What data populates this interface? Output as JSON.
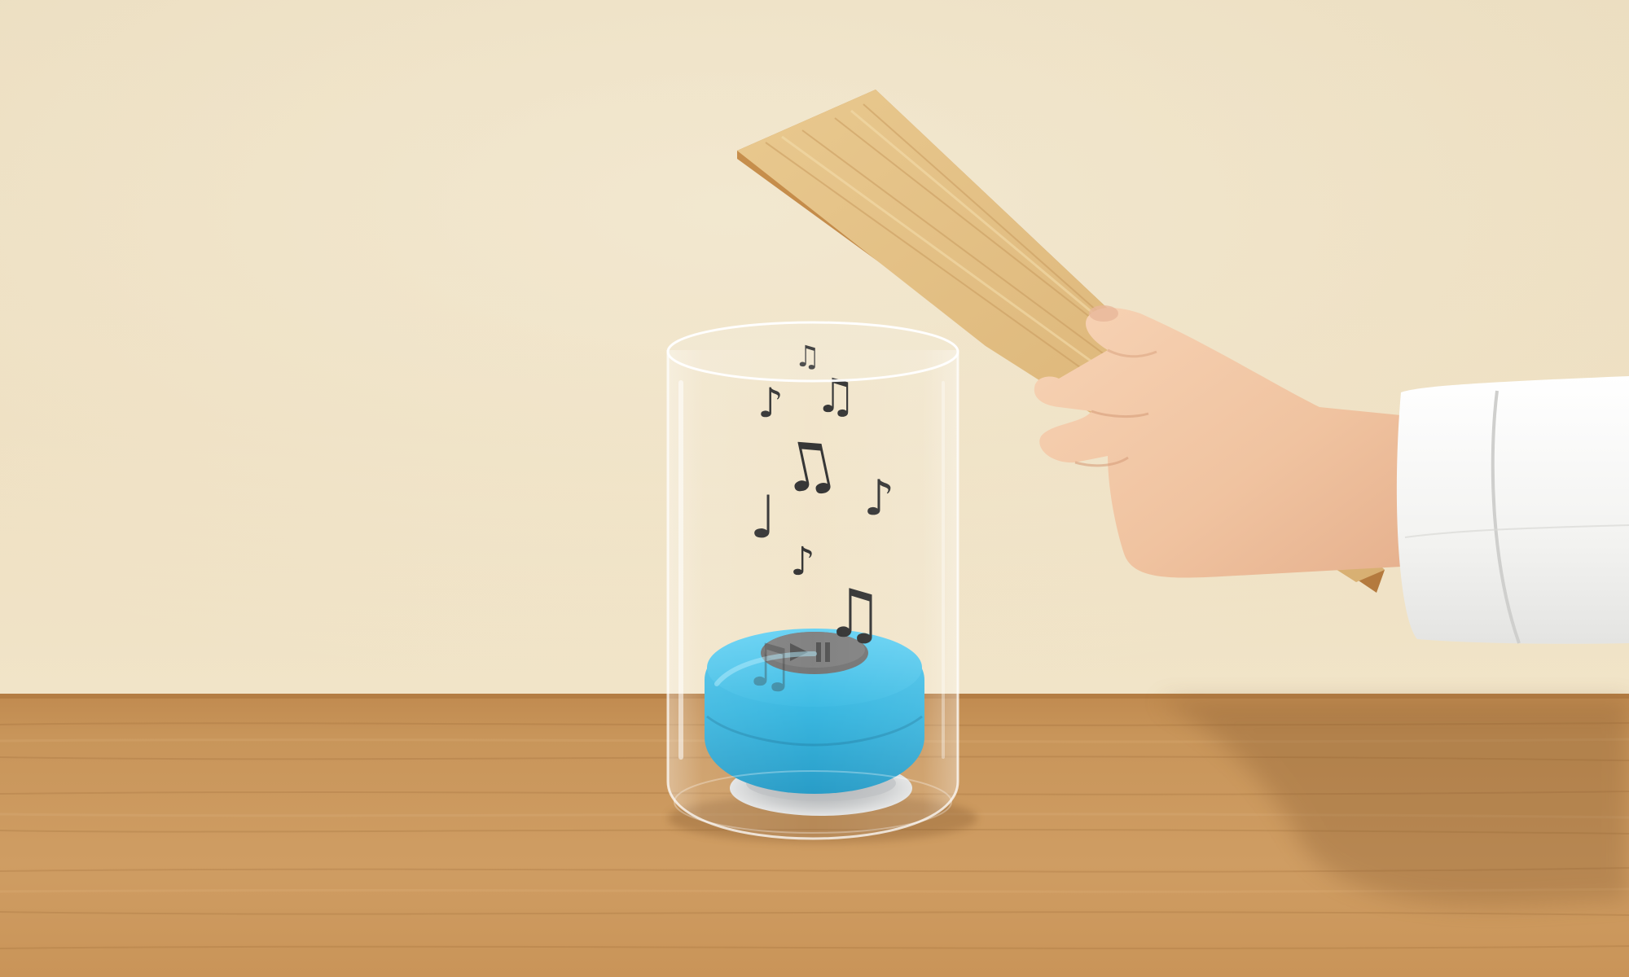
{
  "scene": {
    "subject": "bluetooth-speaker-in-glass-jar",
    "speaker": {
      "color": "#2fb3de",
      "button_glyph": "▶⏸",
      "button_color": "#6f6f6f"
    },
    "notes": [
      {
        "glyph": "♫"
      },
      {
        "glyph": "♪"
      },
      {
        "glyph": "♫"
      },
      {
        "glyph": "♫"
      },
      {
        "glyph": "♪"
      },
      {
        "glyph": "♩"
      },
      {
        "glyph": "♪"
      },
      {
        "glyph": "♫"
      }
    ],
    "colors": {
      "wall_top": "#ebdfc4",
      "wall_bottom": "#f0e4c8",
      "table": "#c99458",
      "lid_wood": "#ddb87e",
      "skin": "#f2c6a4",
      "sleeve": "#f4f4f2"
    }
  }
}
